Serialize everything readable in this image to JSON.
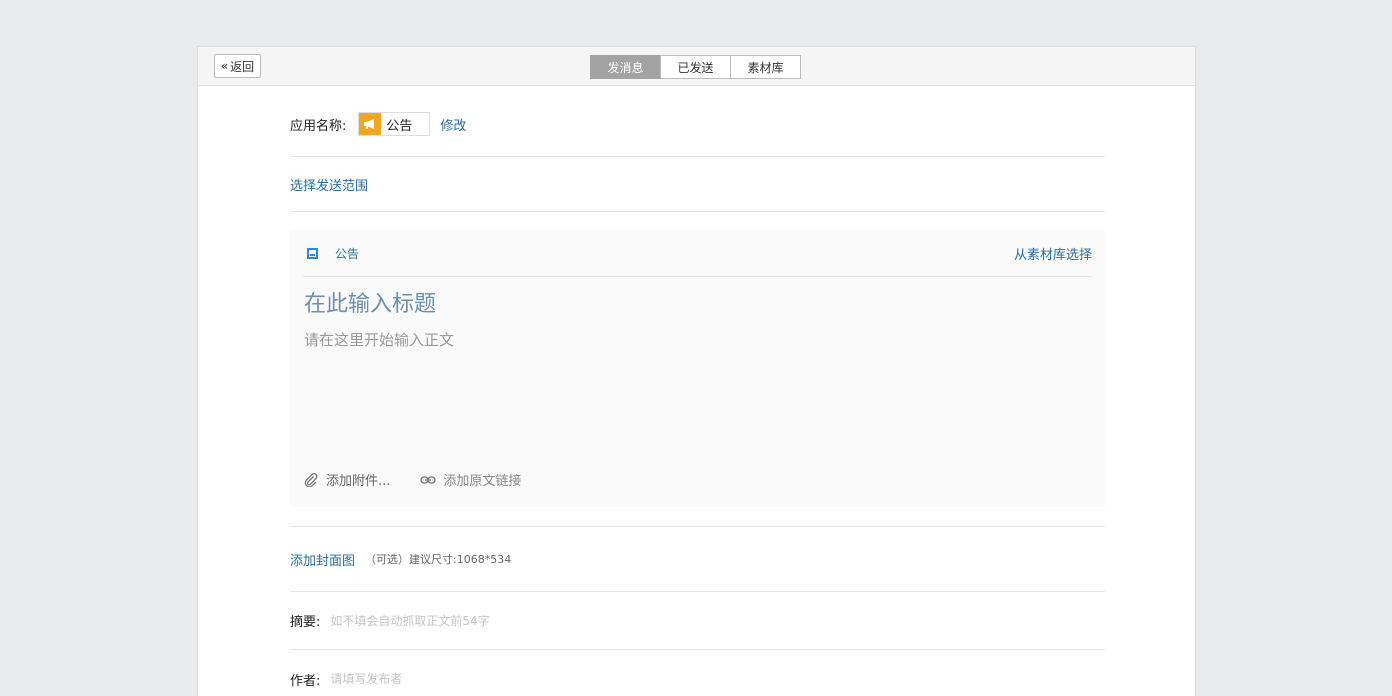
{
  "topbar": {
    "back_label": "返回",
    "tabs": [
      {
        "label": "发消息",
        "active": true
      },
      {
        "label": "已发送",
        "active": false
      },
      {
        "label": "素材库",
        "active": false
      }
    ]
  },
  "app": {
    "label": "应用名称:",
    "name": "公告",
    "icon": "megaphone-icon",
    "icon_color": "#f0a91e",
    "edit_label": "修改"
  },
  "scope": {
    "link_label": "选择发送范围"
  },
  "editor": {
    "type_label": "公告",
    "from_library_label": "从素材库选择",
    "title_placeholder": "在此输入标题",
    "body_placeholder": "请在这里开始输入正文",
    "attach_label": "添加附件...",
    "source_link_label": "添加原文链接"
  },
  "cover": {
    "link_label": "添加封面图",
    "hint": "（可选）建议尺寸:1068*534"
  },
  "summary": {
    "label": "摘要:",
    "placeholder": "如不填会自动抓取正文前54字"
  },
  "author": {
    "label": "作者:",
    "placeholder": "请填写发布者"
  },
  "colors": {
    "accent": "#2b6ca3",
    "active_tab": "#a3a3a3",
    "background": "#e9eaec"
  }
}
